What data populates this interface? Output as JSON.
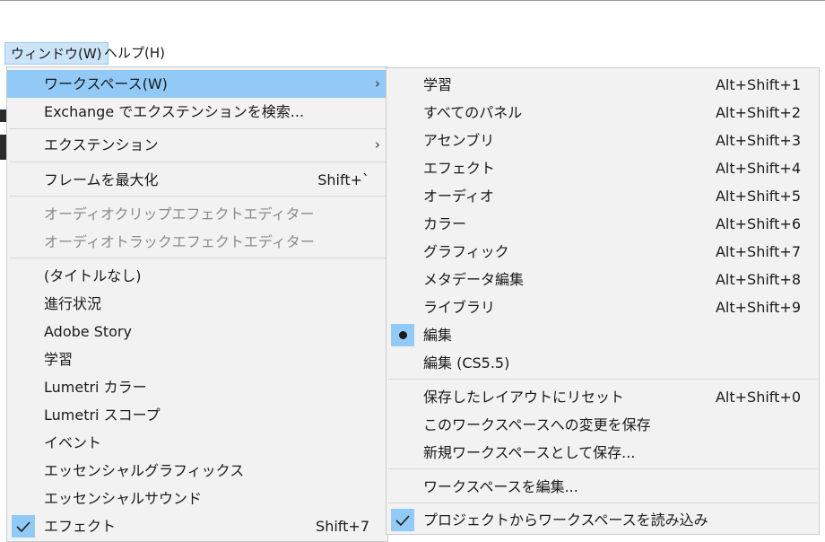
{
  "menubar": {
    "items": [
      {
        "label": "ウィンドウ(W)"
      },
      {
        "label": "ヘルプ(H)"
      }
    ]
  },
  "window_menu": {
    "items": [
      {
        "label": "ワークスペース(W)",
        "submenu_arrow": "›"
      },
      {
        "label": "Exchange でエクステンションを検索..."
      },
      {
        "label": "エクステンション",
        "submenu_arrow": "›"
      },
      {
        "label": "フレームを最大化",
        "shortcut": "Shift+`"
      },
      {
        "label": "オーディオクリップエフェクトエディター"
      },
      {
        "label": "オーディオトラックエフェクトエディター"
      },
      {
        "label": "(タイトルなし)"
      },
      {
        "label": "進行状況"
      },
      {
        "label": "Adobe Story"
      },
      {
        "label": "学習"
      },
      {
        "label": "Lumetri カラー"
      },
      {
        "label": "Lumetri スコープ"
      },
      {
        "label": "イベント"
      },
      {
        "label": "エッセンシャルグラフィックス"
      },
      {
        "label": "エッセンシャルサウンド"
      },
      {
        "label": "エフェクト",
        "shortcut": "Shift+7"
      }
    ]
  },
  "workspace_submenu": {
    "items": [
      {
        "label": "学習",
        "shortcut": "Alt+Shift+1"
      },
      {
        "label": "すべてのパネル",
        "shortcut": "Alt+Shift+2"
      },
      {
        "label": "アセンブリ",
        "shortcut": "Alt+Shift+3"
      },
      {
        "label": "エフェクト",
        "shortcut": "Alt+Shift+4"
      },
      {
        "label": "オーディオ",
        "shortcut": "Alt+Shift+5"
      },
      {
        "label": "カラー",
        "shortcut": "Alt+Shift+6"
      },
      {
        "label": "グラフィック",
        "shortcut": "Alt+Shift+7"
      },
      {
        "label": "メタデータ編集",
        "shortcut": "Alt+Shift+8"
      },
      {
        "label": "ライブラリ",
        "shortcut": "Alt+Shift+9"
      },
      {
        "label": "編集"
      },
      {
        "label": "編集 (CS5.5)"
      },
      {
        "label": "保存したレイアウトにリセット",
        "shortcut": "Alt+Shift+0"
      },
      {
        "label": "このワークスペースへの変更を保存"
      },
      {
        "label": "新規ワークスペースとして保存..."
      },
      {
        "label": "ワークスペースを編集..."
      },
      {
        "label": "プロジェクトからワークスペースを読み込み"
      }
    ]
  },
  "colors": {
    "highlight": "#91c9f7",
    "menu_bg": "#f2f2f2",
    "active_menubar": "#cce4f7"
  }
}
